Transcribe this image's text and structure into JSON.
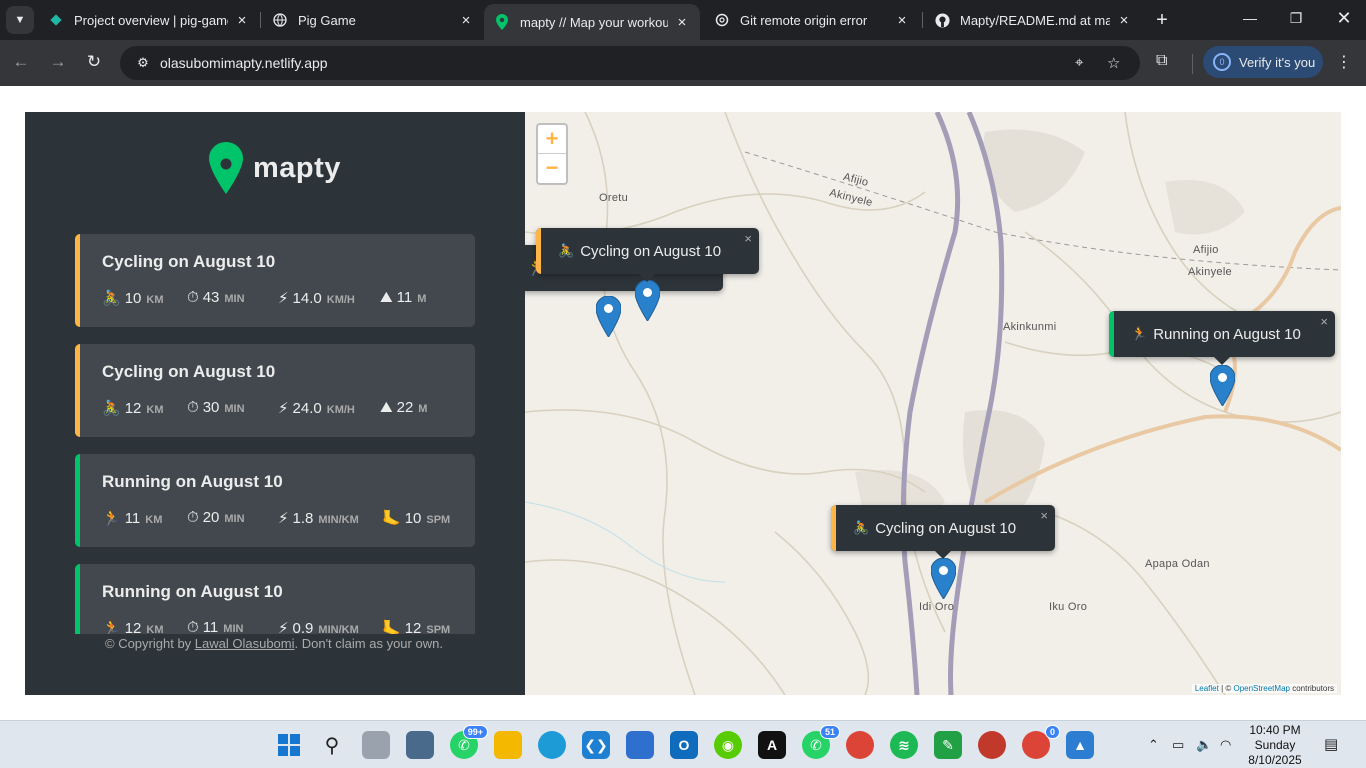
{
  "browser": {
    "tabs": [
      {
        "label": "Project overview | pig-game",
        "active": false
      },
      {
        "label": "Pig Game",
        "active": false
      },
      {
        "label": "mapty // Map your workouts",
        "active": true
      },
      {
        "label": "Git remote origin error",
        "active": false
      },
      {
        "label": "Mapty/README.md at main",
        "active": false
      }
    ],
    "url": "olasubomimapty.netlify.app",
    "verify_label": "Verify it's you",
    "verify_count": "0"
  },
  "app": {
    "logo_text": "mapty",
    "workouts": [
      {
        "type": "cycling",
        "title": "Cycling on August 10",
        "icon": "🚴",
        "distance": "10",
        "duration": "43",
        "speed": "14.0",
        "speed_unit": "km/h",
        "extra_icon": "⛰",
        "extra": "11",
        "extra_unit": "m"
      },
      {
        "type": "cycling",
        "title": "Cycling on August 10",
        "icon": "🚴",
        "distance": "12",
        "duration": "30",
        "speed": "24.0",
        "speed_unit": "km/h",
        "extra_icon": "⛰",
        "extra": "22",
        "extra_unit": "m"
      },
      {
        "type": "running",
        "title": "Running on August 10",
        "icon": "🏃",
        "distance": "11",
        "duration": "20",
        "speed": "1.8",
        "speed_unit": "min/km",
        "extra_icon": "🦶",
        "extra": "10",
        "extra_unit": "spm"
      },
      {
        "type": "running",
        "title": "Running on August 10",
        "icon": "🏃",
        "distance": "12",
        "duration": "11",
        "speed": "0.9",
        "speed_unit": "min/km",
        "extra_icon": "🦶",
        "extra": "12",
        "extra_unit": "spm"
      }
    ],
    "units": {
      "distance": "km",
      "duration": "min",
      "duration_icon": "⏱",
      "speed_icon": "⚡"
    },
    "copyright_prefix": "© Copyright by ",
    "copyright_author": "Lawal Olasubomi",
    "copyright_suffix": ". Don't claim as your own."
  },
  "map": {
    "zoom_in": "+",
    "zoom_out": "−",
    "places": [
      "Oretu",
      "Afijio",
      "Akinyele",
      "Afijio",
      "Akinyele",
      "Akinkunmi",
      "Apapa Odan",
      "Idi Oro",
      "Iku Oro"
    ],
    "popups": [
      {
        "type": "cycling",
        "icon": "🚴",
        "label": "Cycling on August 10"
      },
      {
        "type": "running",
        "icon": "🏃",
        "label": "Running on August 10"
      },
      {
        "type": "cycling",
        "icon": "🚴",
        "label": "Cycling on August 10"
      }
    ],
    "close_glyph": "×",
    "attribution_leaflet": "Leaflet",
    "attribution_sep": " | © ",
    "attribution_osm": "OpenStreetMap",
    "attribution_suffix": " contributors"
  },
  "taskbar": {
    "whatsapp_badge": "99+",
    "whatsapp2_badge": "51",
    "chrome_badge": "0",
    "time": "10:40 PM",
    "day": "Sunday",
    "date": "8/10/2025"
  },
  "colors": {
    "cycling": "#ffb545",
    "running": "#00c46a",
    "sidebar_bg": "#2d3439",
    "card_bg": "#42484d"
  }
}
